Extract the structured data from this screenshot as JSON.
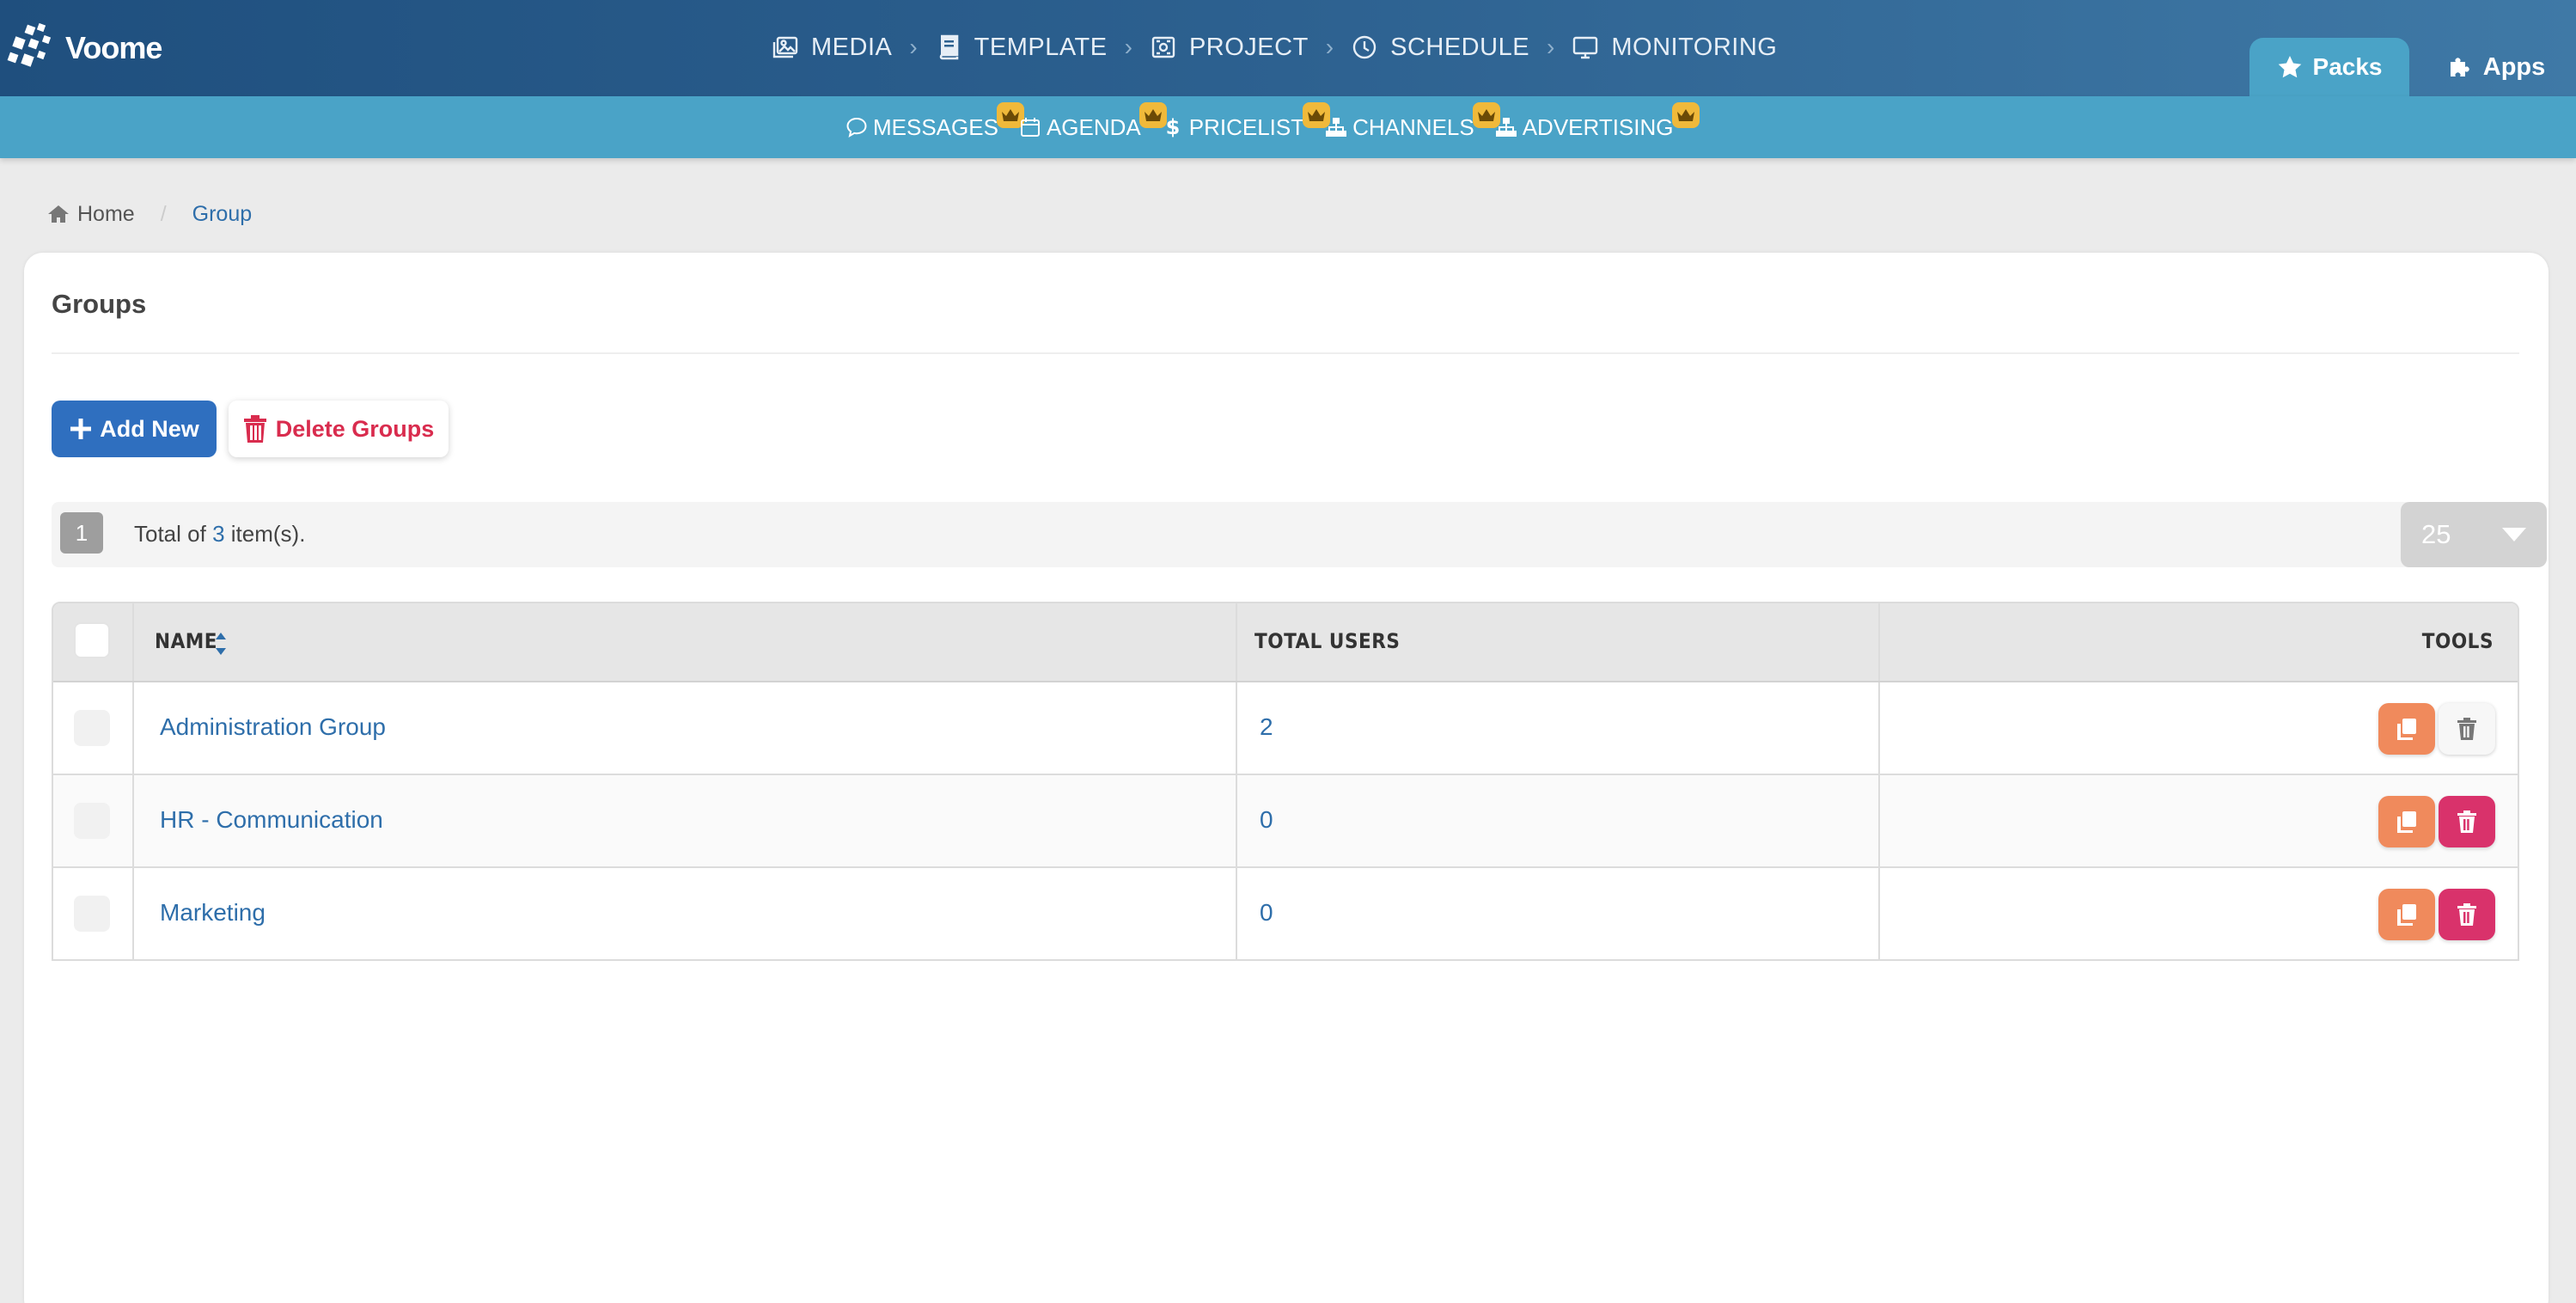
{
  "app": {
    "name": "Voome"
  },
  "main_nav": [
    {
      "label": "MEDIA",
      "icon": "images-icon"
    },
    {
      "label": "TEMPLATE",
      "icon": "book-icon"
    },
    {
      "label": "PROJECT",
      "icon": "project-icon"
    },
    {
      "label": "SCHEDULE",
      "icon": "clock-icon"
    },
    {
      "label": "MONITORING",
      "icon": "monitor-icon"
    }
  ],
  "header_tabs": {
    "packs": "Packs",
    "apps": "Apps"
  },
  "sub_nav": [
    {
      "label": "MESSAGES",
      "icon": "comment-icon",
      "premium": true
    },
    {
      "label": "AGENDA",
      "icon": "calendar-icon",
      "premium": true
    },
    {
      "label": "PRICELIST",
      "icon": "dollar-icon",
      "premium": true
    },
    {
      "label": "CHANNELS",
      "icon": "sitemap-icon",
      "premium": true
    },
    {
      "label": "ADVERTISING",
      "icon": "sitemap-icon",
      "premium": true
    }
  ],
  "breadcrumb": {
    "home": "Home",
    "current": "Group"
  },
  "page": {
    "title": "Groups",
    "add_label": "Add New",
    "delete_label": "Delete Groups",
    "page_number": "1",
    "total_prefix": "Total of ",
    "total_count": "3",
    "total_suffix": " item(s).",
    "per_page": "25"
  },
  "table": {
    "columns": {
      "name": "NAME",
      "total_users": "TOTAL USERS",
      "tools": "TOOLS"
    },
    "rows": [
      {
        "name": "Administration Group",
        "total_users": "2",
        "delete_enabled": false
      },
      {
        "name": "HR - Communication",
        "total_users": "0",
        "delete_enabled": true
      },
      {
        "name": "Marketing",
        "total_users": "0",
        "delete_enabled": true
      }
    ]
  },
  "colors": {
    "header_dark": "#1f4f7e",
    "header_accent": "#4aa3c7",
    "primary": "#2f6fbf",
    "danger": "#d92c4e",
    "copy_button": "#f08a5c",
    "delete_button": "#d9326b",
    "crown": "#f0b93a"
  }
}
